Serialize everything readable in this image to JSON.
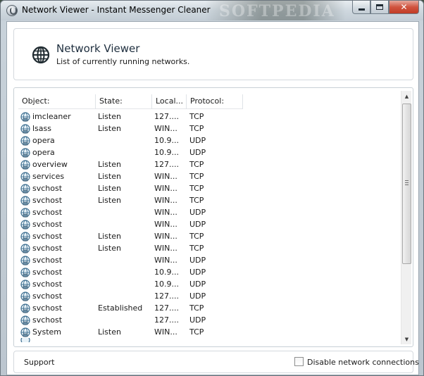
{
  "window": {
    "title": "Network Viewer - Instant Messenger Cleaner",
    "watermark": "SOFTPEDIA",
    "buttons": {
      "minimize": "minimize",
      "maximize": "maximize",
      "close": "✕"
    }
  },
  "header": {
    "title": "Network Viewer",
    "subtitle": "List of currently running networks.",
    "icon": "globe-icon"
  },
  "list": {
    "columns": [
      "Object:",
      "State:",
      "Local...",
      "Protocol:"
    ],
    "rows": [
      {
        "object": "imcleaner",
        "state": "Listen",
        "local": "127....",
        "protocol": "TCP"
      },
      {
        "object": "lsass",
        "state": "Listen",
        "local": "WIN...",
        "protocol": "TCP"
      },
      {
        "object": "opera",
        "state": "",
        "local": "10.9...",
        "protocol": "UDP"
      },
      {
        "object": "opera",
        "state": "",
        "local": "10.9...",
        "protocol": "UDP"
      },
      {
        "object": "overview",
        "state": "Listen",
        "local": "127....",
        "protocol": "TCP"
      },
      {
        "object": "services",
        "state": "Listen",
        "local": "WIN...",
        "protocol": "TCP"
      },
      {
        "object": "svchost",
        "state": "Listen",
        "local": "WIN...",
        "protocol": "TCP"
      },
      {
        "object": "svchost",
        "state": "Listen",
        "local": "WIN...",
        "protocol": "TCP"
      },
      {
        "object": "svchost",
        "state": "",
        "local": "WIN...",
        "protocol": "UDP"
      },
      {
        "object": "svchost",
        "state": "",
        "local": "WIN...",
        "protocol": "UDP"
      },
      {
        "object": "svchost",
        "state": "Listen",
        "local": "WIN...",
        "protocol": "TCP"
      },
      {
        "object": "svchost",
        "state": "Listen",
        "local": "WIN...",
        "protocol": "TCP"
      },
      {
        "object": "svchost",
        "state": "",
        "local": "WIN...",
        "protocol": "UDP"
      },
      {
        "object": "svchost",
        "state": "",
        "local": "10.9...",
        "protocol": "UDP"
      },
      {
        "object": "svchost",
        "state": "",
        "local": "10.9...",
        "protocol": "UDP"
      },
      {
        "object": "svchost",
        "state": "",
        "local": "127....",
        "protocol": "UDP"
      },
      {
        "object": "svchost",
        "state": "Established",
        "local": "127....",
        "protocol": "TCP"
      },
      {
        "object": "svchost",
        "state": "",
        "local": "127....",
        "protocol": "UDP"
      },
      {
        "object": "System",
        "state": "Listen",
        "local": "WIN...",
        "protocol": "TCP"
      }
    ]
  },
  "footer": {
    "support_label": "Support",
    "disable_checkbox_label": "Disable network connections",
    "disable_checked": false
  },
  "colors": {
    "accent": "#1e2e3e",
    "close_button": "#c94a34"
  }
}
